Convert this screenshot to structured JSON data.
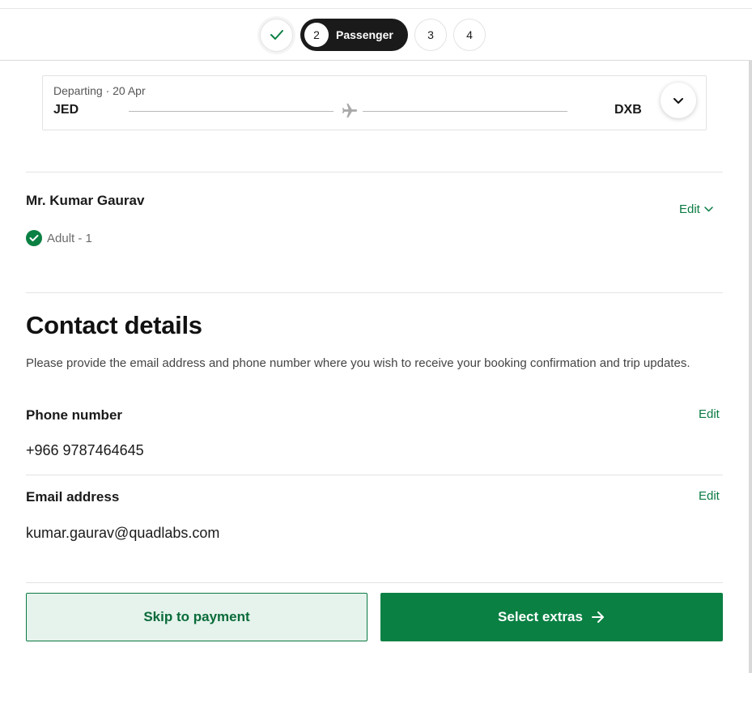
{
  "stepper": {
    "steps": [
      {
        "state": "completed",
        "icon": "checkmark-icon"
      },
      {
        "number": "2",
        "label": "Passenger",
        "state": "active"
      },
      {
        "number": "3",
        "state": "upcoming"
      },
      {
        "number": "4",
        "state": "upcoming"
      }
    ]
  },
  "flight": {
    "departing_label": "Departing · 20 Apr",
    "origin": "JED",
    "destination": "DXB",
    "icons": {
      "route": "airplane-icon",
      "expand": "chevron-down-icon"
    }
  },
  "passenger": {
    "name": "Mr. Kumar Gaurav",
    "type": "Adult - 1",
    "edit_label": "Edit",
    "icons": {
      "status": "check-circle-icon",
      "edit": "chevron-down-icon"
    }
  },
  "contact": {
    "title": "Contact details",
    "description": "Please provide the email address and phone number where you wish to receive your booking confirmation and trip updates.",
    "phone": {
      "label": "Phone number",
      "value": "+966 9787464645",
      "edit_label": "Edit"
    },
    "email": {
      "label": "Email address",
      "value": "kumar.gaurav@quadlabs.com",
      "edit_label": "Edit"
    }
  },
  "actions": {
    "skip_label": "Skip to payment",
    "next_label": "Select extras",
    "next_icon": "arrow-right-icon"
  },
  "colors": {
    "accent": "#0a8043",
    "accent_text": "#0a7a42",
    "skip_bg": "#e5f3ec",
    "dark": "#1a1a1a"
  }
}
